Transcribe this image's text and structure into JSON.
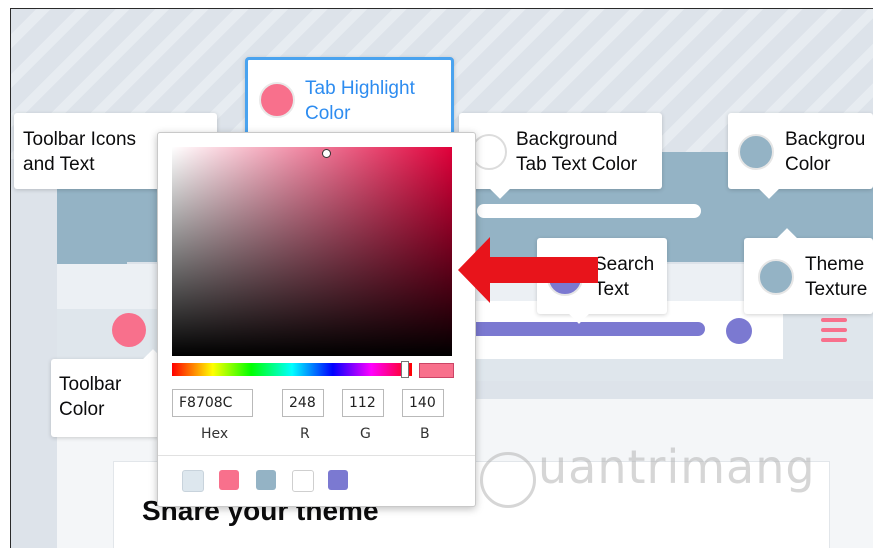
{
  "callouts": {
    "toolbar_icons": {
      "label": "Toolbar Icons\nand Text",
      "color": "#f8708c"
    },
    "tab_highlight": {
      "label": "Tab Highlight\nColor",
      "color": "#f8708c"
    },
    "background_tab_text": {
      "label": "Background\nTab Text Color",
      "color": "#ffffff"
    },
    "background_color": {
      "label": "Backgrou\nColor",
      "color": "#94b3c5"
    },
    "search_text": {
      "label": "Search\nText",
      "color": "#7b79d1"
    },
    "theme_texture": {
      "label": "Theme\nTexture",
      "color": "#94b3c5"
    },
    "toolbar_color": {
      "label": "Toolbar\nColor",
      "color": "#dfe6ec"
    }
  },
  "color_picker": {
    "hex": "F8708C",
    "r": "248",
    "g": "112",
    "b": "140",
    "hex_label": "Hex",
    "r_label": "R",
    "g_label": "G",
    "b_label": "B",
    "current_color": "#f8708c",
    "presets": [
      "#dde7ee",
      "#f8708c",
      "#94b3c5",
      "#ffffff",
      "#7b79d1"
    ]
  },
  "content": {
    "share_title": "Share your theme"
  },
  "watermark": "uantrimang"
}
